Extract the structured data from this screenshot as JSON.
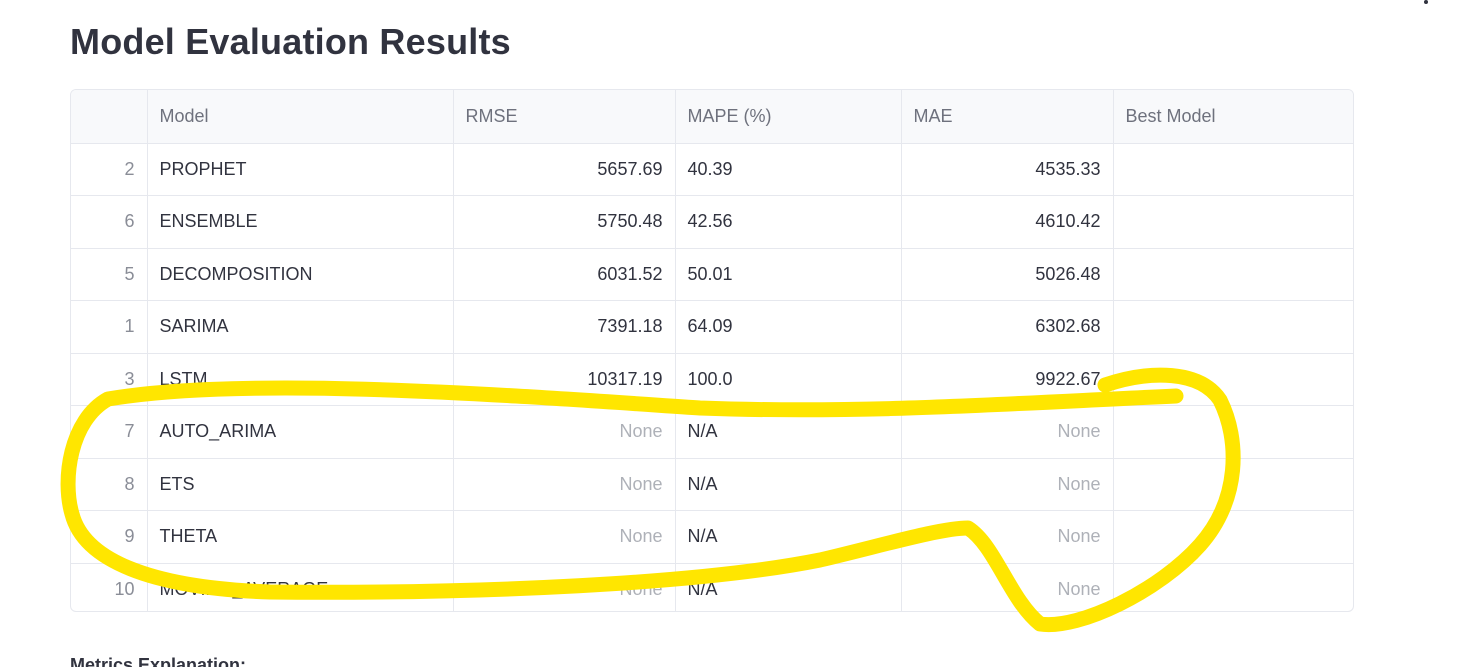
{
  "page": {
    "title": "Model Evaluation Results",
    "footer_label": "Metrics Explanation:"
  },
  "table": {
    "columns": [
      "",
      "Model",
      "RMSE",
      "MAPE (%)",
      "MAE",
      "Best Model"
    ],
    "rows": [
      {
        "index": "2",
        "model": "PROPHET",
        "rmse": "5657.69",
        "mape": "40.39",
        "mae": "4535.33",
        "best": ""
      },
      {
        "index": "6",
        "model": "ENSEMBLE",
        "rmse": "5750.48",
        "mape": "42.56",
        "mae": "4610.42",
        "best": ""
      },
      {
        "index": "5",
        "model": "DECOMPOSITION",
        "rmse": "6031.52",
        "mape": "50.01",
        "mae": "5026.48",
        "best": ""
      },
      {
        "index": "1",
        "model": "SARIMA",
        "rmse": "7391.18",
        "mape": "64.09",
        "mae": "6302.68",
        "best": ""
      },
      {
        "index": "3",
        "model": "LSTM",
        "rmse": "10317.19",
        "mape": "100.0",
        "mae": "9922.67",
        "best": ""
      },
      {
        "index": "7",
        "model": "AUTO_ARIMA",
        "rmse": "None",
        "mape": "N/A",
        "mae": "None",
        "best": ""
      },
      {
        "index": "8",
        "model": "ETS",
        "rmse": "None",
        "mape": "N/A",
        "mae": "None",
        "best": ""
      },
      {
        "index": "9",
        "model": "THETA",
        "rmse": "None",
        "mape": "N/A",
        "mae": "None",
        "best": ""
      },
      {
        "index": "10",
        "model": "MOVING_AVERAGE",
        "rmse": "None",
        "mape": "N/A",
        "mae": "None",
        "best": ""
      }
    ]
  },
  "colors": {
    "highlight_annotation": "#ffe600",
    "text": "#31333f",
    "muted_text": "#aeb1b8",
    "header_bg": "#f8f9fb",
    "border": "#e6e8ee"
  }
}
